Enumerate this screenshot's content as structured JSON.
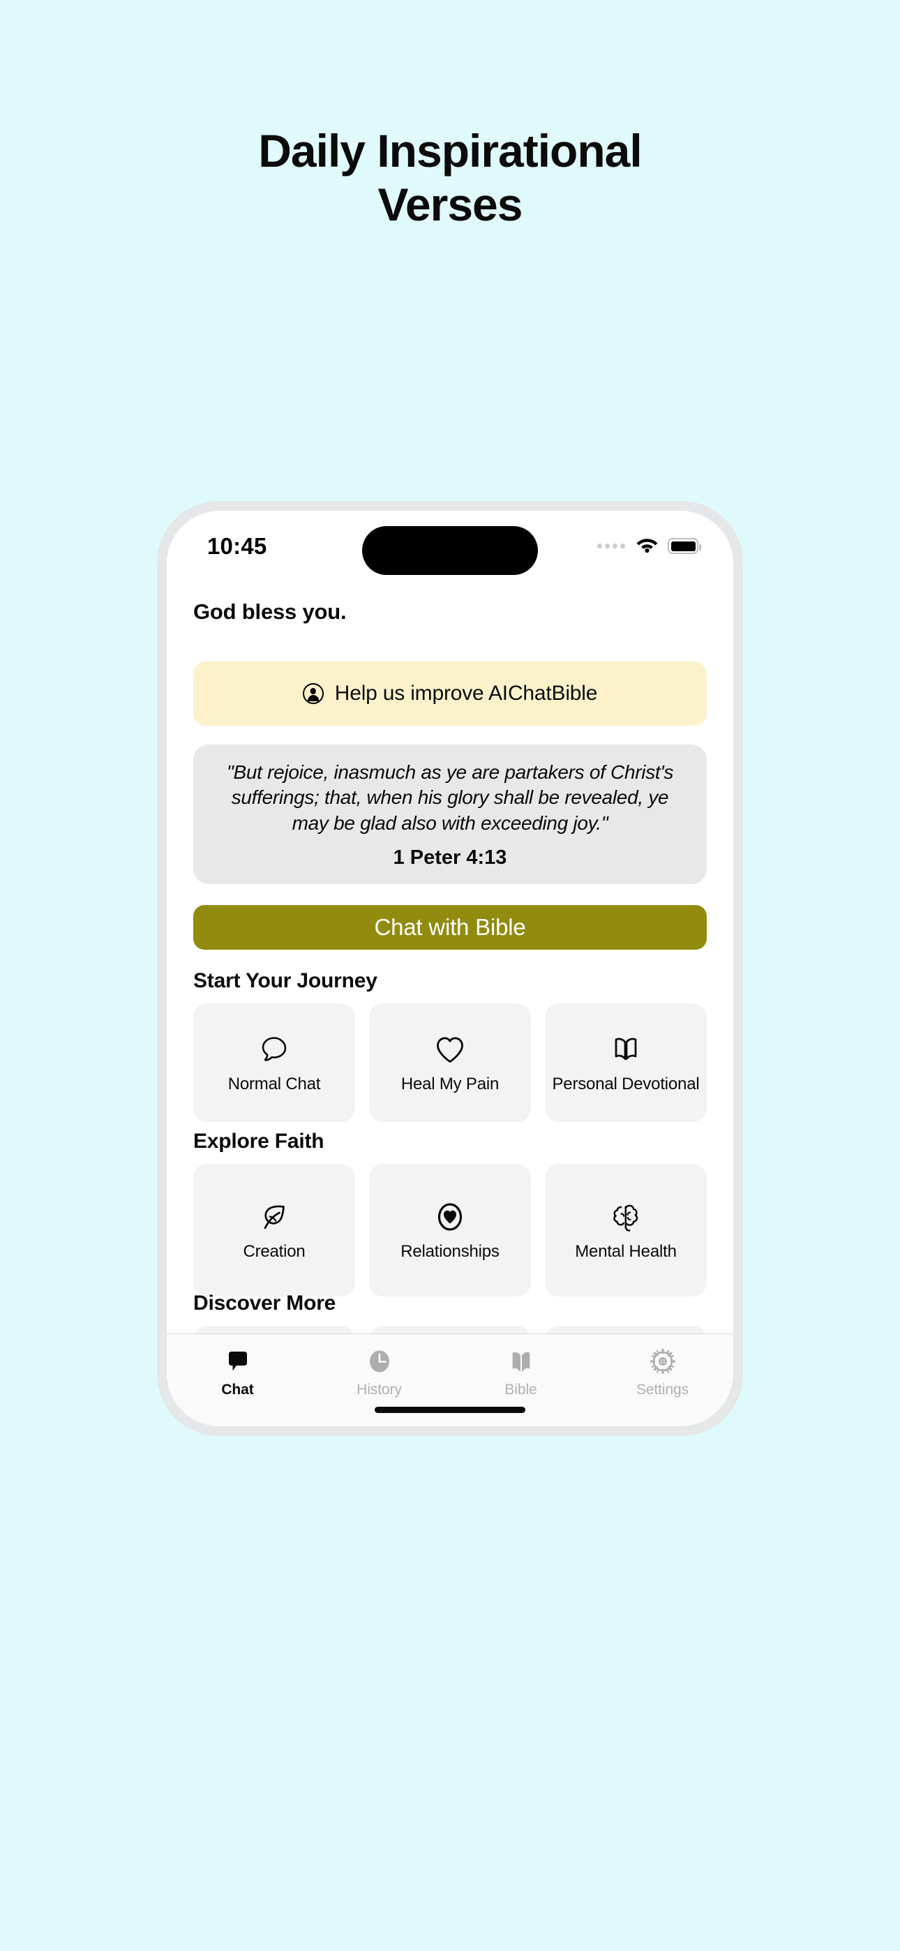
{
  "hero": {
    "line1": "Daily Inspirational",
    "line2": "Verses"
  },
  "colors": {
    "page_background": "#E0FAFB",
    "accent_button": "#918C10",
    "banner_background": "#FBF2CC",
    "verse_card_background": "#E8E8E8",
    "tile_background": "#F3F3F3"
  },
  "statusbar": {
    "time": "10:45",
    "signal_icon": "signal-dots-icon",
    "wifi_icon": "wifi-icon",
    "battery_icon": "battery-icon"
  },
  "app": {
    "greeting": "God bless you.",
    "improve_banner": {
      "icon": "person-circle-icon",
      "label": "Help us improve AIChatBible"
    },
    "verse": {
      "text": "\"But rejoice, inasmuch as ye are partakers of Christ's sufferings; that, when his glory shall be revealed, ye may be glad also with exceeding joy.\"",
      "reference": "1 Peter 4:13"
    },
    "cta": {
      "label": "Chat with Bible"
    },
    "sections": [
      {
        "title": "Start Your Journey",
        "tiles": [
          {
            "label": "Normal Chat",
            "icon": "speech-bubble-icon"
          },
          {
            "label": "Heal My Pain",
            "icon": "heart-outline-icon"
          },
          {
            "label": "Personal Devotional",
            "icon": "open-book-icon"
          }
        ]
      },
      {
        "title": "Explore Faith",
        "tiles": [
          {
            "label": "Creation",
            "icon": "leaf-icon"
          },
          {
            "label": "Relationships",
            "icon": "heart-in-circle-icon"
          },
          {
            "label": "Mental Health",
            "icon": "brain-icon"
          }
        ]
      },
      {
        "title": "Discover More",
        "tiles": [
          {
            "label": "",
            "icon": ""
          },
          {
            "label": "",
            "icon": ""
          },
          {
            "label": "",
            "icon": ""
          }
        ]
      }
    ],
    "tabs": [
      {
        "label": "Chat",
        "icon": "chat-bubble-filled-icon",
        "active": true
      },
      {
        "label": "History",
        "icon": "clock-icon",
        "active": false
      },
      {
        "label": "Bible",
        "icon": "book-filled-icon",
        "active": false
      },
      {
        "label": "Settings",
        "icon": "gear-icon",
        "active": false
      }
    ]
  }
}
